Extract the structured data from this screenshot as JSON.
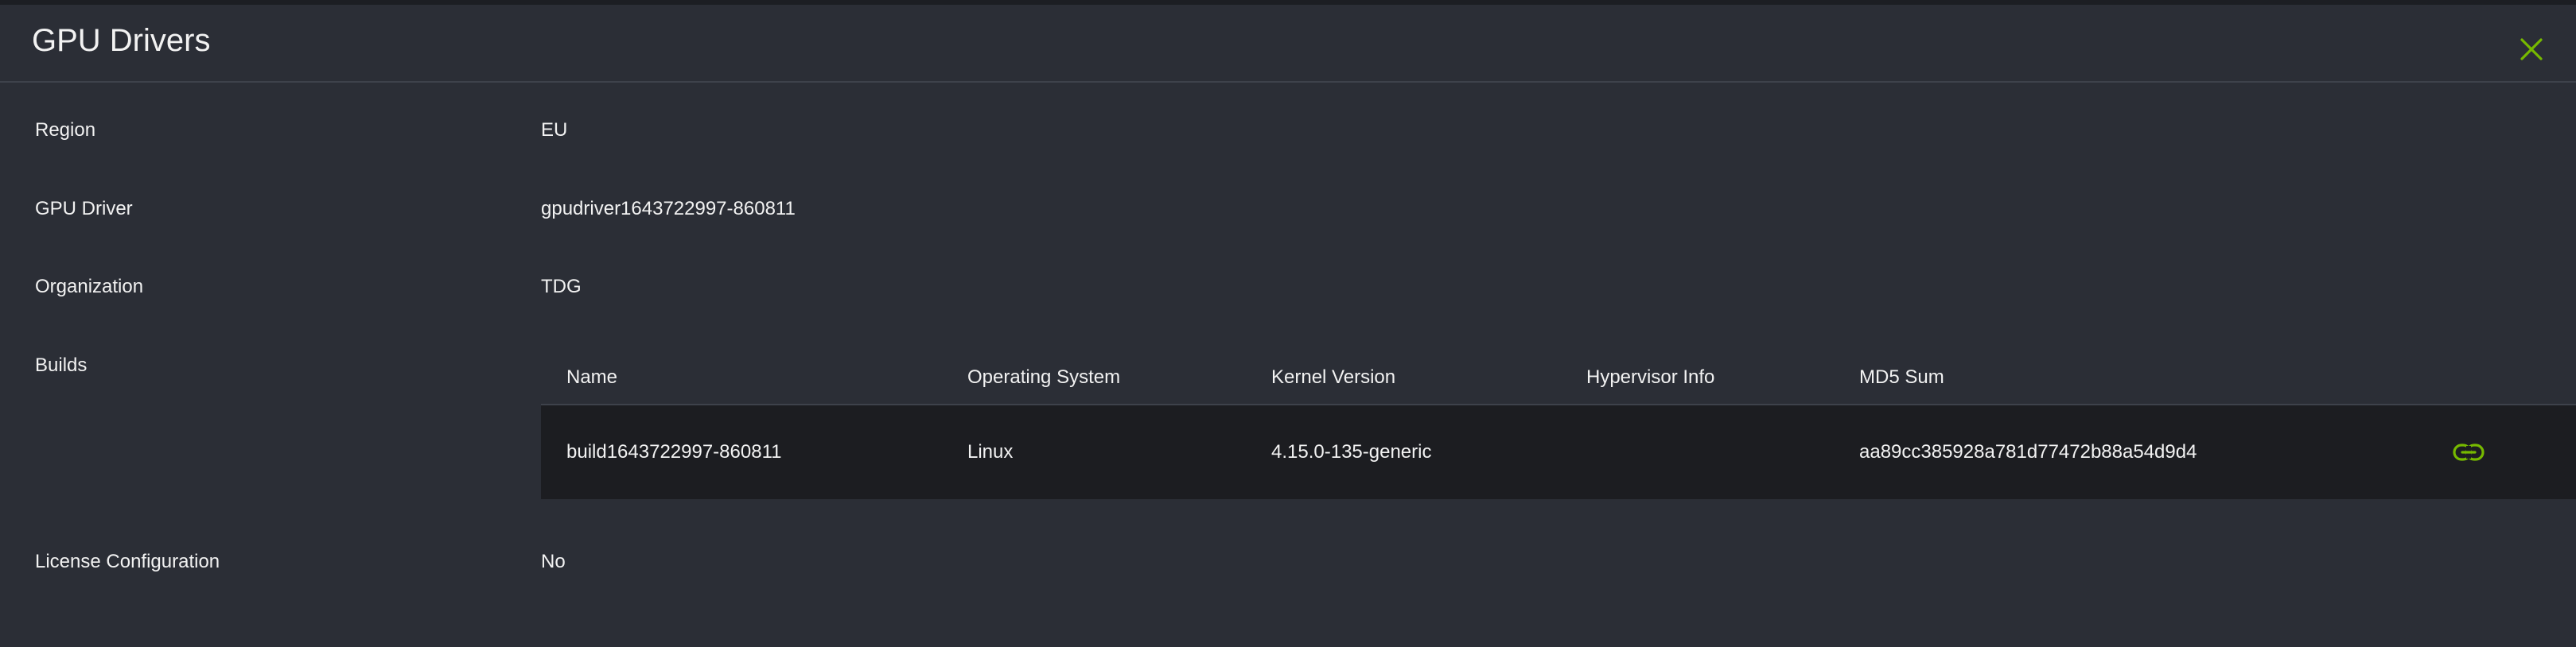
{
  "dialog": {
    "title": "GPU Drivers",
    "close_icon": "close-icon",
    "accent_color": "#76b900"
  },
  "details": {
    "region": {
      "label": "Region",
      "value": "EU"
    },
    "gpu_driver": {
      "label": "GPU Driver",
      "value": "gpudriver1643722997-860811"
    },
    "organization": {
      "label": "Organization",
      "value": "TDG"
    },
    "builds": {
      "label": "Builds"
    },
    "license_configuration": {
      "label": "License Configuration",
      "value": "No"
    }
  },
  "builds_table": {
    "columns": [
      "Name",
      "Operating System",
      "Kernel Version",
      "Hypervisor Info",
      "MD5 Sum"
    ],
    "rows": [
      {
        "name": "build1643722997-860811",
        "operating_system": "Linux",
        "kernel_version": "4.15.0-135-generic",
        "hypervisor_info": "",
        "md5_sum": "aa89cc385928a781d77472b88a54d9d4",
        "action_icon": "link-icon"
      }
    ]
  }
}
